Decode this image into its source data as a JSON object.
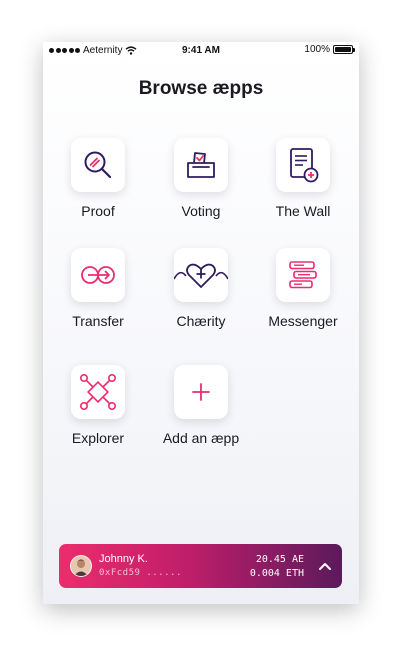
{
  "status_bar": {
    "carrier": "Aeternity",
    "time": "9:41 AM",
    "battery": "100%",
    "battery_level": 1.0
  },
  "page": {
    "title": "Browse æpps"
  },
  "apps": [
    {
      "label": "Proof",
      "icon": "magnifier-icon"
    },
    {
      "label": "Voting",
      "icon": "ballot-box-icon"
    },
    {
      "label": "The Wall",
      "icon": "document-add-icon"
    },
    {
      "label": "Transfer",
      "icon": "transfer-arrow-icon"
    },
    {
      "label": "Chærity",
      "icon": "heart-plus-icon"
    },
    {
      "label": "Messenger",
      "icon": "messages-icon"
    },
    {
      "label": "Explorer",
      "icon": "network-nodes-icon"
    },
    {
      "label": "Add an æpp",
      "icon": "plus-icon"
    }
  ],
  "account": {
    "name": "Johnny K.",
    "address": "0xFcd59 ......",
    "balance_ae": "20.45 AE",
    "balance_eth": "0.004 ETH"
  },
  "colors": {
    "accent_pink": "#ec2d6c",
    "accent_purple": "#2e1c5e",
    "gradient_end": "#5b1a5c"
  }
}
